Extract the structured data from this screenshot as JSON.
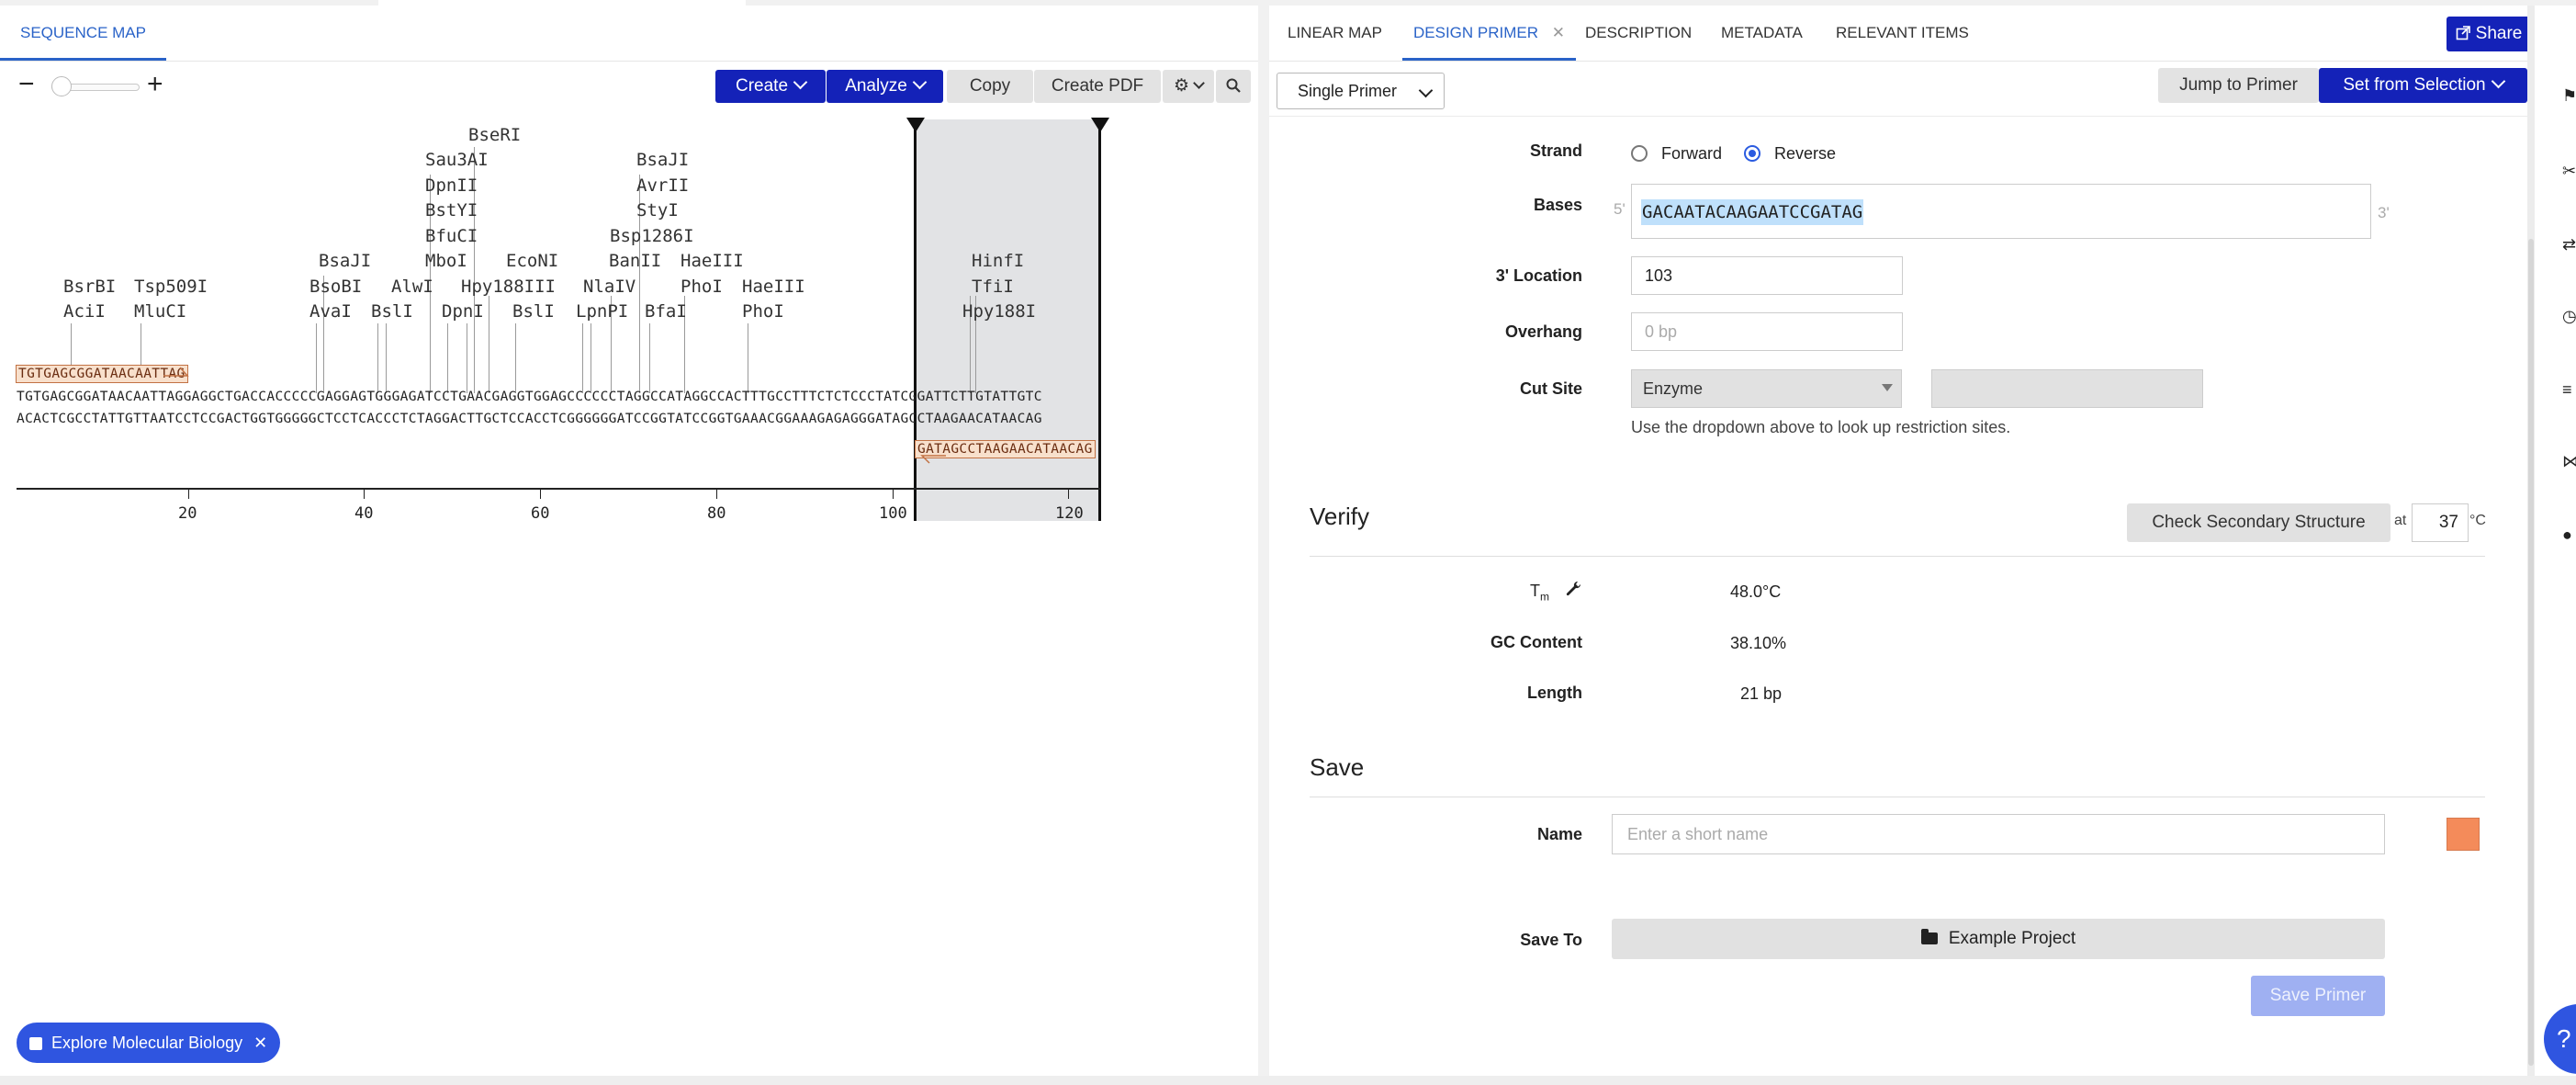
{
  "left": {
    "tab_label": "SEQUENCE MAP",
    "toolbar": {
      "zoom_minus": "−",
      "zoom_plus": "+",
      "create": "Create",
      "analyze": "Analyze",
      "copy": "Copy",
      "create_pdf": "Create PDF",
      "settings_icon": "gear-icon",
      "search_icon": "search-icon"
    },
    "enzymes": [
      {
        "name": "BseRI"
      },
      {
        "name": "Sau3AI"
      },
      {
        "name": "DpnII"
      },
      {
        "name": "BstYI"
      },
      {
        "name": "BfuCI"
      },
      {
        "name": "MboI"
      },
      {
        "name": "BsaJI"
      },
      {
        "name": "AvrII"
      },
      {
        "name": "StyI"
      },
      {
        "name": "Bsp1286I"
      },
      {
        "name": "BsaJI"
      },
      {
        "name": "EcoNI"
      },
      {
        "name": "BanII"
      },
      {
        "name": "HaeIII"
      },
      {
        "name": "HinfI"
      },
      {
        "name": "BsrBI"
      },
      {
        "name": "Tsp509I"
      },
      {
        "name": "BsoBI"
      },
      {
        "name": "AlwI"
      },
      {
        "name": "Hpy188III"
      },
      {
        "name": "NlaIV"
      },
      {
        "name": "PhoI"
      },
      {
        "name": "HaeIII"
      },
      {
        "name": "TfiI"
      },
      {
        "name": "AciI"
      },
      {
        "name": "MluCI"
      },
      {
        "name": "AvaI"
      },
      {
        "name": "BslI"
      },
      {
        "name": "DpnI"
      },
      {
        "name": "BslI"
      },
      {
        "name": "LpnPI"
      },
      {
        "name": "BfaI"
      },
      {
        "name": "PhoI"
      },
      {
        "name": "Hpy188I"
      }
    ],
    "primer_forward": "TGTGAGCGGATAACAATTAG",
    "seq_top": "TGTGAGCGGATAACAATTAGGAGGCTGACCACCCCCGAGGAGTGGGAGATCCTGAACGAGGTGGAGCCCCCCTAGGCCATAGGCCACTTTGCCTTTCTCTCCCTATCGGATTCTTGTATTGTC",
    "seq_bottom": "ACACTCGCCTATTGTTAATCCTCCGACTGGTGGGGGCTCCTCACCCTCTAGGACTTGCTCCACCTCGGGGGGATCCGGTATCCGGTGAAACGGAAAGAGAGGGATAGCCTAAGAACATAACAG",
    "primer_reverse": "GATAGCCTAAGAACATAACAG",
    "axis_ticks": [
      "20",
      "40",
      "60",
      "80",
      "100",
      "120"
    ],
    "explore_label": "Explore Molecular Biology",
    "explore_close": "✕"
  },
  "right": {
    "tabs": [
      {
        "label": "LINEAR MAP"
      },
      {
        "label": "DESIGN PRIMER"
      },
      {
        "label": "DESCRIPTION"
      },
      {
        "label": "METADATA"
      },
      {
        "label": "RELEVANT ITEMS"
      }
    ],
    "tab_close": "✕",
    "share": "Share",
    "primer_type": "Single Primer",
    "jump_to_primer": "Jump to Primer",
    "set_from_selection": "Set from Selection",
    "strand": {
      "label": "Strand",
      "forward": "Forward",
      "reverse": "Reverse",
      "selected": "Reverse"
    },
    "bases": {
      "label": "Bases",
      "prime5": "5'",
      "prime3": "3'",
      "value": "GACAATACAAGAATCCGATAG"
    },
    "location": {
      "label": "3' Location",
      "value": "103"
    },
    "overhang": {
      "label": "Overhang",
      "placeholder": "0 bp"
    },
    "cut_site": {
      "label": "Cut Site",
      "selected": "Enzyme",
      "help": "Use the dropdown above to look up restriction sites."
    },
    "verify": {
      "title": "Verify",
      "check_button": "Check Secondary Structure",
      "at": "at",
      "temperature": "37",
      "temp_unit": "°C",
      "tm_label": "T",
      "tm_sub": "m",
      "tm_value": "48.0°C",
      "gc_label": "GC Content",
      "gc_value": "38.10%",
      "length_label": "Length",
      "length_value": "21 bp"
    },
    "save": {
      "title": "Save",
      "name_label": "Name",
      "name_placeholder": "Enter a short name",
      "save_to_label": "Save To",
      "project": "Example Project",
      "save_button": "Save Primer",
      "swatch_color": "#f48b5a"
    },
    "help_bubble": "?"
  }
}
